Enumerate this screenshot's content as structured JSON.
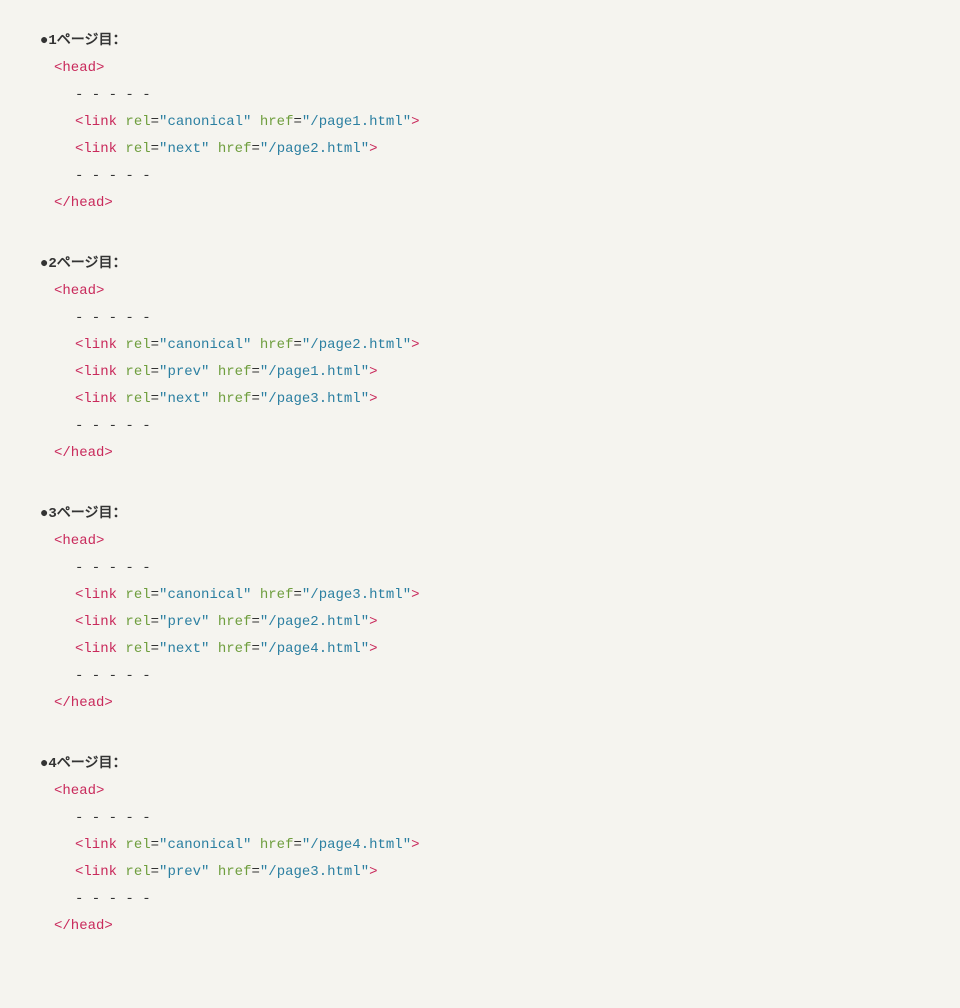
{
  "sections": [
    {
      "heading": "●1ページ目：",
      "lines": [
        {
          "indent": 1,
          "type": "open",
          "tag": "head"
        },
        {
          "indent": 2,
          "type": "dashes"
        },
        {
          "indent": 3,
          "type": "void",
          "tag": "link",
          "attrs": [
            {
              "name": "rel",
              "value": "canonical"
            },
            {
              "name": "href",
              "value": "/page1.html"
            }
          ]
        },
        {
          "indent": 3,
          "type": "void",
          "tag": "link",
          "attrs": [
            {
              "name": "rel",
              "value": "next"
            },
            {
              "name": "href",
              "value": "/page2.html"
            }
          ]
        },
        {
          "indent": 2,
          "type": "dashes"
        },
        {
          "indent": 1,
          "type": "close",
          "tag": "head"
        }
      ]
    },
    {
      "heading": "●2ページ目：",
      "lines": [
        {
          "indent": 1,
          "type": "open",
          "tag": "head"
        },
        {
          "indent": 2,
          "type": "dashes"
        },
        {
          "indent": 3,
          "type": "void",
          "tag": "link",
          "attrs": [
            {
              "name": "rel",
              "value": "canonical"
            },
            {
              "name": "href",
              "value": "/page2.html"
            }
          ]
        },
        {
          "indent": 3,
          "type": "void",
          "tag": "link",
          "attrs": [
            {
              "name": "rel",
              "value": "prev"
            },
            {
              "name": "href",
              "value": "/page1.html"
            }
          ]
        },
        {
          "indent": 3,
          "type": "void",
          "tag": "link",
          "attrs": [
            {
              "name": "rel",
              "value": "next"
            },
            {
              "name": "href",
              "value": "/page3.html"
            }
          ]
        },
        {
          "indent": 2,
          "type": "dashes"
        },
        {
          "indent": 1,
          "type": "close",
          "tag": "head"
        }
      ]
    },
    {
      "heading": "●3ページ目：",
      "lines": [
        {
          "indent": 1,
          "type": "open",
          "tag": "head"
        },
        {
          "indent": 2,
          "type": "dashes"
        },
        {
          "indent": 3,
          "type": "void",
          "tag": "link",
          "attrs": [
            {
              "name": "rel",
              "value": "canonical"
            },
            {
              "name": "href",
              "value": "/page3.html"
            }
          ]
        },
        {
          "indent": 3,
          "type": "void",
          "tag": "link",
          "attrs": [
            {
              "name": "rel",
              "value": "prev"
            },
            {
              "name": "href",
              "value": "/page2.html"
            }
          ]
        },
        {
          "indent": 3,
          "type": "void",
          "tag": "link",
          "attrs": [
            {
              "name": "rel",
              "value": "next"
            },
            {
              "name": "href",
              "value": "/page4.html"
            }
          ]
        },
        {
          "indent": 2,
          "type": "dashes"
        },
        {
          "indent": 1,
          "type": "close",
          "tag": "head"
        }
      ]
    },
    {
      "heading": "●4ページ目：",
      "lines": [
        {
          "indent": 1,
          "type": "open",
          "tag": "head"
        },
        {
          "indent": 2,
          "type": "dashes"
        },
        {
          "indent": 3,
          "type": "void",
          "tag": "link",
          "attrs": [
            {
              "name": "rel",
              "value": "canonical"
            },
            {
              "name": "href",
              "value": "/page4.html"
            }
          ]
        },
        {
          "indent": 3,
          "type": "void",
          "tag": "link",
          "attrs": [
            {
              "name": "rel",
              "value": "prev"
            },
            {
              "name": "href",
              "value": "/page3.html"
            }
          ]
        },
        {
          "indent": 2,
          "type": "dashes"
        },
        {
          "indent": 1,
          "type": "close",
          "tag": "head"
        }
      ]
    }
  ],
  "dashes_text": "- - - - -"
}
